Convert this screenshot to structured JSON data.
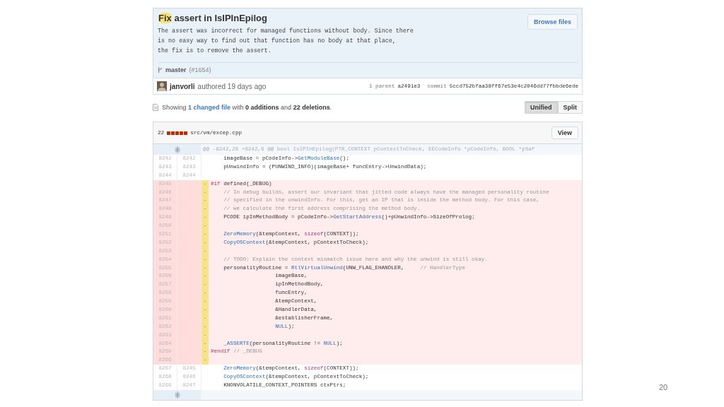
{
  "commit": {
    "title": "Fix",
    "title_rest": "assert in IsIPInEpilog",
    "message": [
      "The assert was incorrect for managed functions without body. Since there",
      "is no easy way to find out that function has no body at that place,",
      "the fix is to remove the assert."
    ],
    "browse_button": "Browse files",
    "branch": "master",
    "pull_ref": "(#1654)",
    "author": "janvorli",
    "authored": "authored 19 days ago",
    "parent_label": "1 parent",
    "parent_sha": "a2491e3",
    "commit_label": "commit",
    "commit_sha": "5ccd752bfaa38ff67e53e4c2046dd77fbbde6ede"
  },
  "summary": {
    "prefix": "Showing",
    "link": "1 changed file",
    "rest": "with **0 additions** and **22 deletions**."
  },
  "view_modes": [
    {
      "label": "Unified",
      "selected": true
    },
    {
      "label": "Split",
      "selected": false
    }
  ],
  "file": {
    "changes": "22",
    "path": "src/vm/excep.cpp",
    "view_button": "View",
    "hunk": "@@ -8242,28 +8242,6 @@ bool IsIPInEpilog(PTR_CONTEXT pContextToCheck, EECodeInfo *pCodeInfo, BOOL *pSaf",
    "lines": [
      {
        "kind": "context",
        "old": "8242",
        "new": "8242",
        "code": [
          {
            "t": "    imageBase = pCodeInfo->"
          },
          {
            "t": "GetModuleBase",
            "kind": "function"
          },
          {
            "t": "();"
          }
        ]
      },
      {
        "kind": "context",
        "old": "8243",
        "new": "8243",
        "code": [
          {
            "t": "    pUnwindInfo = (PUNWIND_INFO)(imageBase+ funcEntry->UnwindData);"
          }
        ]
      },
      {
        "kind": "context",
        "old": "8244",
        "new": "8244"
      },
      {
        "kind": "deleted",
        "old": "8245",
        "sign": "-",
        "code": [
          {
            "t": "#if",
            "kind": "directive"
          },
          {
            "t": " defined(_DEBUG)"
          }
        ]
      },
      {
        "kind": "deleted",
        "old": "8246",
        "sign": "-",
        "code": [
          {
            "t": "    // In debug builds, assert our invariant that jitted code always have the managed personality routine",
            "kind": "comment"
          }
        ]
      },
      {
        "kind": "deleted",
        "old": "8247",
        "sign": "-",
        "code": [
          {
            "t": "    // specified in the unwindInfo. For this, get an IP that is inside the method body. For this case,",
            "kind": "comment"
          }
        ]
      },
      {
        "kind": "deleted",
        "old": "8248",
        "sign": "-",
        "code": [
          {
            "t": "    // we calculate the first address comprising the method body.",
            "kind": "comment"
          }
        ]
      },
      {
        "kind": "deleted",
        "old": "8249",
        "sign": "-",
        "code": [
          {
            "t": "    PCODE ipInMethodBody = pCodeInfo->"
          },
          {
            "t": "GetStartAddress",
            "kind": "function"
          },
          {
            "t": "()+pUnwindInfo->SizeOfProlog;"
          }
        ]
      },
      {
        "kind": "deleted",
        "old": "8250",
        "sign": "-"
      },
      {
        "kind": "deleted",
        "old": "8251",
        "sign": "-",
        "code": [
          {
            "t": "    ZeroMemory",
            "kind": "function"
          },
          {
            "t": "(&tempContext, "
          },
          {
            "t": "sizeof",
            "kind": "keyword"
          },
          {
            "t": "(CONTEXT));"
          }
        ]
      },
      {
        "kind": "deleted",
        "old": "8252",
        "sign": "-",
        "code": [
          {
            "t": "    CopyOSContext",
            "kind": "function"
          },
          {
            "t": "(&tempContext, pContextToCheck);"
          }
        ]
      },
      {
        "kind": "deleted",
        "old": "8253",
        "sign": "-"
      },
      {
        "kind": "deleted",
        "old": "8254",
        "sign": "-",
        "code": [
          {
            "t": "    // TODO: Explain the context mismatch issue here and why the unwind is still okay.",
            "kind": "comment"
          }
        ]
      },
      {
        "kind": "deleted",
        "old": "8255",
        "sign": "-",
        "code": [
          {
            "t": "    personalityRoutine = "
          },
          {
            "t": "RtlVirtualUnwind",
            "kind": "function"
          },
          {
            "t": "(UNW_FLAG_EHANDLER,     "
          },
          {
            "t": "// HandlerType",
            "kind": "comment"
          }
        ]
      },
      {
        "kind": "deleted",
        "old": "8256",
        "sign": "-",
        "code": [
          {
            "t": "                    imageBase,"
          }
        ]
      },
      {
        "kind": "deleted",
        "old": "8257",
        "sign": "-",
        "code": [
          {
            "t": "                    ipInMethodBody,"
          }
        ]
      },
      {
        "kind": "deleted",
        "old": "8258",
        "sign": "-",
        "code": [
          {
            "t": "                    funcEntry,"
          }
        ]
      },
      {
        "kind": "deleted",
        "old": "8259",
        "sign": "-",
        "code": [
          {
            "t": "                    &tempContext,"
          }
        ]
      },
      {
        "kind": "deleted",
        "old": "8260",
        "sign": "-",
        "code": [
          {
            "t": "                    &HandlerData,"
          }
        ]
      },
      {
        "kind": "deleted",
        "old": "8261",
        "sign": "-",
        "code": [
          {
            "t": "                    &establisherFrame,"
          }
        ]
      },
      {
        "kind": "deleted",
        "old": "8262",
        "sign": "-",
        "code": [
          {
            "t": "                    NULL",
            "kind": "function"
          },
          {
            "t": ");"
          }
        ]
      },
      {
        "kind": "deleted",
        "old": "8263",
        "sign": "-"
      },
      {
        "kind": "deleted",
        "old": "8264",
        "sign": "-",
        "code": [
          {
            "t": "    _ASSERTE",
            "kind": "function"
          },
          {
            "t": "(personalityRoutine != "
          },
          {
            "t": "NULL",
            "kind": "function"
          },
          {
            "t": ");"
          }
        ]
      },
      {
        "kind": "deleted",
        "old": "8265",
        "sign": "-",
        "code": [
          {
            "t": "#endif",
            "kind": "directive"
          },
          {
            "t": " // _DEBUG",
            "kind": "comment"
          }
        ]
      },
      {
        "kind": "deleted",
        "old": "8266",
        "sign": "-"
      },
      {
        "kind": "context",
        "old": "8267",
        "new": "8245",
        "code": [
          {
            "t": "    ZeroMemory",
            "kind": "function"
          },
          {
            "t": "(&tempContext, "
          },
          {
            "t": "sizeof",
            "kind": "keyword"
          },
          {
            "t": "(CONTEXT));"
          }
        ]
      },
      {
        "kind": "context",
        "old": "8268",
        "new": "8246",
        "code": [
          {
            "t": "    CopyOSContext",
            "kind": "function"
          },
          {
            "t": "(&tempContext, pContextToCheck);"
          }
        ]
      },
      {
        "kind": "context",
        "old": "8269",
        "new": "8247",
        "code": [
          {
            "t": "    KNONVOLATILE_CONTEXT_POINTERS ctxPtrs;"
          }
        ]
      }
    ]
  },
  "slide_number": "20"
}
